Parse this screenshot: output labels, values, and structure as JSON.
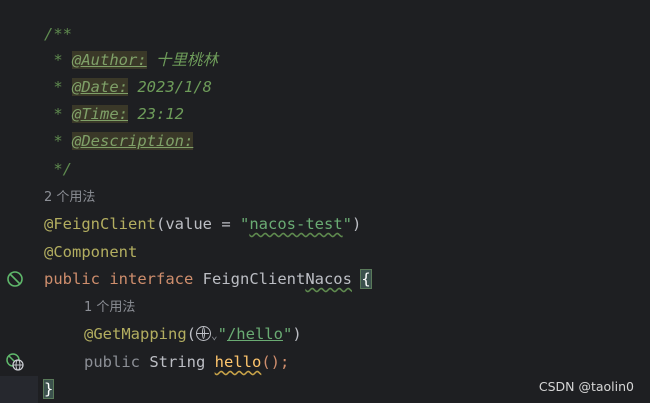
{
  "editor": {
    "doc_open": "/**",
    "doc_star": " * ",
    "author_tag": "@Author:",
    "author_val": " 十里桃林",
    "date_tag": "@Date:",
    "date_val": " 2023/1/8",
    "time_tag": "@Time:",
    "time_val": " 23:12",
    "desc_tag": "@Description:",
    "doc_close": " */",
    "usage_hint_1": "2 个用法",
    "feign_ann": "@FeignClient",
    "feign_open": "(",
    "feign_param": "value = ",
    "feign_q1": "\"",
    "feign_val": "nacos-test",
    "feign_q2": "\"",
    "feign_close": ")",
    "component_ann": "@Component",
    "kw_public": "public",
    "kw_interface": " interface",
    "iface_name_a": " FeignClient",
    "iface_name_b": "Nacos",
    "brace_open": "{",
    "usage_hint_2": "1 个用法",
    "getmapping_ann": "@GetMapping",
    "gm_open": "(",
    "gm_q1": "\"",
    "gm_path": "/hello",
    "gm_q2": "\"",
    "gm_close": ")",
    "m_public": "public",
    "m_type": " String ",
    "m_name": "hello",
    "m_parens": "();",
    "brace_close": "}"
  },
  "watermark": "CSDN @taolin0"
}
